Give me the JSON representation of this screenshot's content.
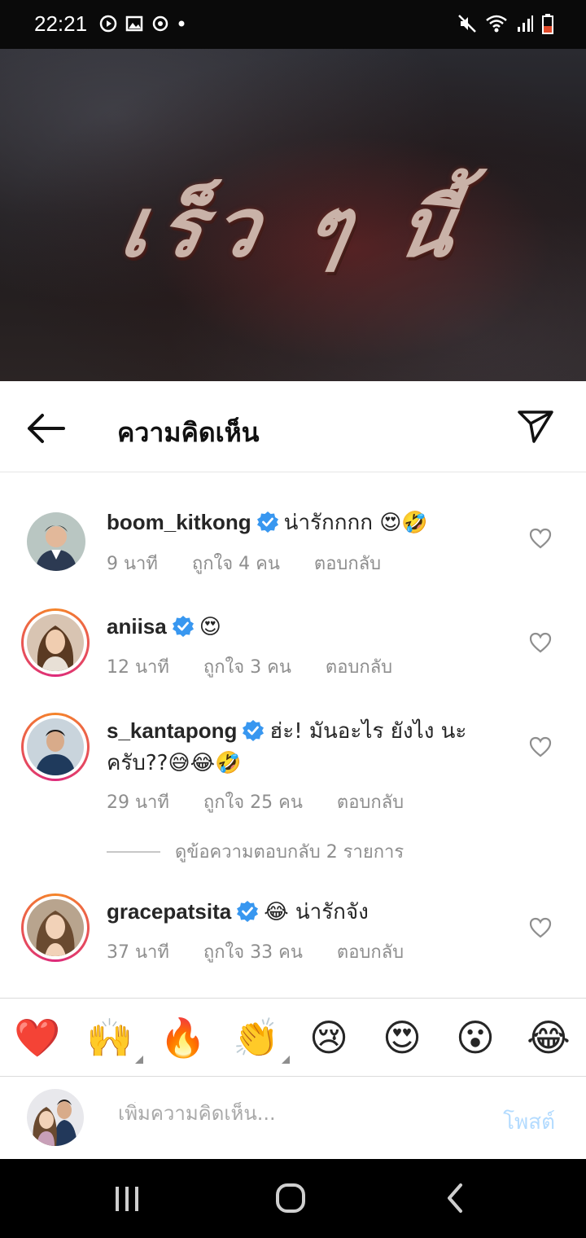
{
  "status_bar": {
    "time": "22:21"
  },
  "banner": {
    "title": "เร็ว ๆ นี้"
  },
  "header": {
    "title": "ความคิดเห็น"
  },
  "comments": [
    {
      "username": "boom_kitkong",
      "verified": true,
      "text": "น่ารักกกก 😍🤣",
      "time": "9 นาที",
      "likes": "ถูกใจ 4 คน",
      "reply": "ตอบกลับ"
    },
    {
      "username": "aniisa",
      "verified": true,
      "text": "😍",
      "time": "12 นาที",
      "likes": "ถูกใจ 3 คน",
      "reply": "ตอบกลับ"
    },
    {
      "username": "s_kantapong",
      "verified": true,
      "text": "ฮ่ะ! มันอะไร ยังไง นะ",
      "text2": "ครับ??😅😂🤣",
      "time": "29 นาที",
      "likes": "ถูกใจ 25 คน",
      "reply": "ตอบกลับ"
    },
    {
      "username": "gracepatsita",
      "verified": true,
      "text": "😂 น่ารักจัง",
      "time": "37 นาที",
      "likes": "ถูกใจ 33 คน",
      "reply": "ตอบกลับ"
    }
  ],
  "view_replies": "ดูข้อความตอบกลับ 2 รายการ",
  "reactions": [
    "❤️",
    "🙌",
    "🔥",
    "👏",
    "😢",
    "😍",
    "😮",
    "😂"
  ],
  "input": {
    "placeholder": "เพิ่มความคิดเห็น...",
    "post_label": "โพสต์"
  },
  "colors": {
    "accent": "#3897f0",
    "post_disabled": "#b3dbff",
    "meta": "#8e8e8e",
    "ring_start": "#f58529",
    "ring_end": "#dd2a7b"
  }
}
